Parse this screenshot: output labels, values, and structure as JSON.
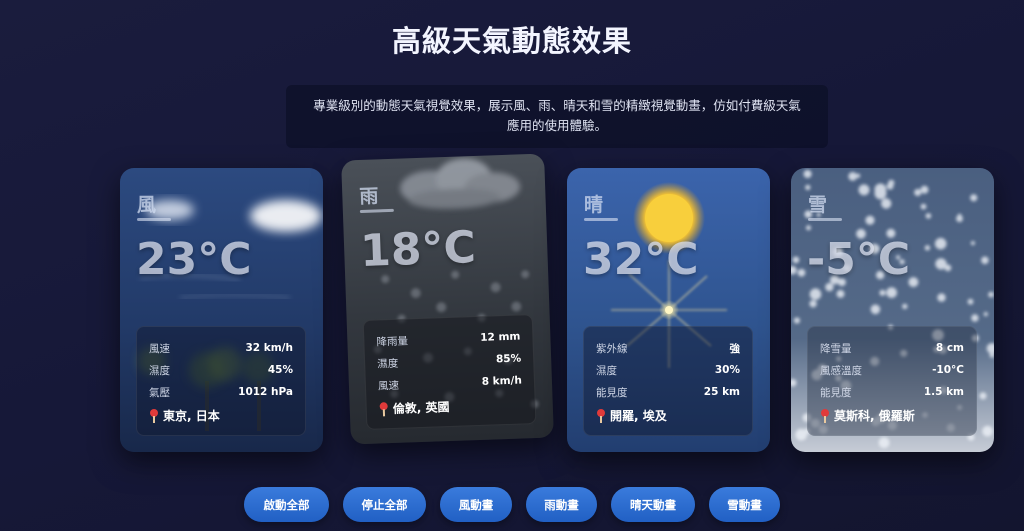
{
  "page": {
    "title": "高級天氣動態效果",
    "subtitle_line1": "專業級別的動態天氣視覺效果，展示風、雨、晴天和雪的精緻視覺動畫，仿如付費級天氣",
    "subtitle_line2": "應用的使用體驗。"
  },
  "cards": [
    {
      "id": "wind",
      "label": "風",
      "temp": "23°C",
      "rows": [
        {
          "key": "風速",
          "val": "32 km/h"
        },
        {
          "key": "濕度",
          "val": "45%"
        },
        {
          "key": "氣壓",
          "val": "1012 hPa"
        }
      ],
      "location": "東京, 日本"
    },
    {
      "id": "rain",
      "label": "雨",
      "temp": "18°C",
      "rows": [
        {
          "key": "降雨量",
          "val": "12 mm"
        },
        {
          "key": "濕度",
          "val": "85%"
        },
        {
          "key": "風速",
          "val": "8 km/h"
        }
      ],
      "location": "倫敦, 英國"
    },
    {
      "id": "sunny",
      "label": "晴",
      "temp": "32°C",
      "rows": [
        {
          "key": "紫外線",
          "val": "強"
        },
        {
          "key": "濕度",
          "val": "30%"
        },
        {
          "key": "能見度",
          "val": "25 km"
        }
      ],
      "location": "開羅, 埃及"
    },
    {
      "id": "snow",
      "label": "雪",
      "temp": "-5°C",
      "rows": [
        {
          "key": "降雪量",
          "val": "8 cm"
        },
        {
          "key": "風感溫度",
          "val": "-10°C"
        },
        {
          "key": "能見度",
          "val": "1.5 km"
        }
      ],
      "location": "莫斯科, 俄羅斯"
    }
  ],
  "buttons": [
    {
      "label": "啟動全部"
    },
    {
      "label": "停止全部"
    },
    {
      "label": "風動畫"
    },
    {
      "label": "雨動畫"
    },
    {
      "label": "晴天動畫"
    },
    {
      "label": "雪動畫"
    }
  ],
  "icons": {
    "location": "map-pin-icon"
  }
}
